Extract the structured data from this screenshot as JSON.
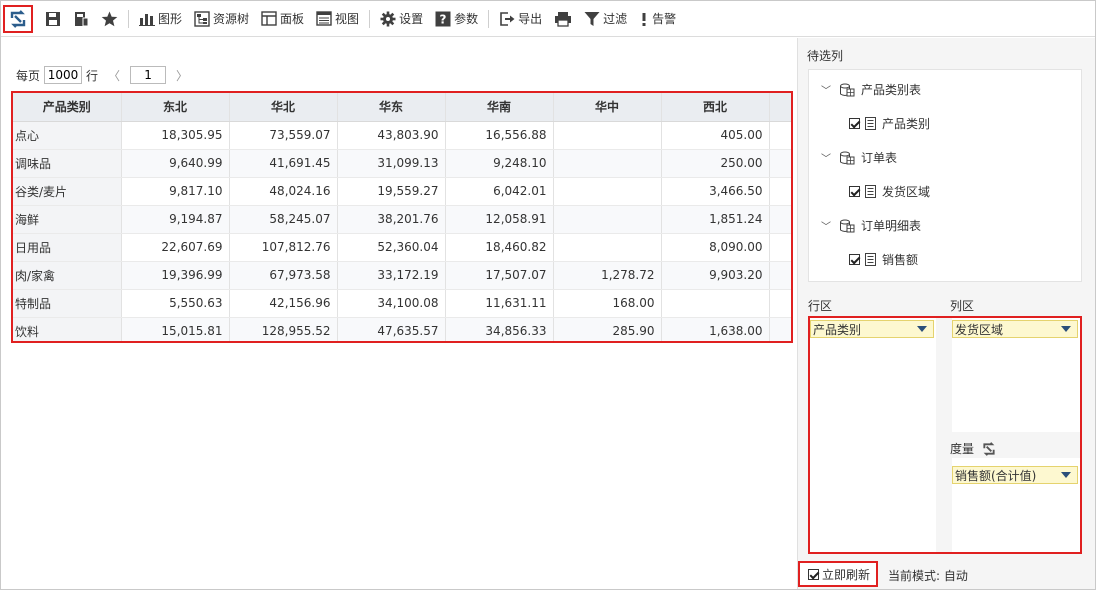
{
  "toolbar": {
    "buttons": [
      {
        "label": "",
        "icon": "save-icon"
      },
      {
        "label": "",
        "icon": "save-as-icon"
      },
      {
        "label": "",
        "icon": "star-icon"
      },
      {
        "label": "图形",
        "icon": "bar-chart-icon"
      },
      {
        "label": "资源树",
        "icon": "resource-tree-icon"
      },
      {
        "label": "面板",
        "icon": "panel-icon"
      },
      {
        "label": "视图",
        "icon": "view-icon"
      },
      {
        "label": "设置",
        "icon": "gear-icon"
      },
      {
        "label": "参数",
        "icon": "question-icon"
      },
      {
        "label": "导出",
        "icon": "export-icon"
      },
      {
        "label": "",
        "icon": "print-icon"
      },
      {
        "label": "过滤",
        "icon": "filter-icon"
      },
      {
        "label": "告警",
        "icon": "alert-icon"
      }
    ]
  },
  "pager": {
    "prefix": "每页",
    "page_size": "1000",
    "suffix": "行",
    "prev": "〈",
    "page": "1",
    "next": "〉"
  },
  "table": {
    "corner_header": "产品类别",
    "columns": [
      "东北",
      "华北",
      "华东",
      "华南",
      "华中",
      "西北"
    ],
    "rows": [
      {
        "label": "点心",
        "values": [
          "18,305.95",
          "73,559.07",
          "43,803.90",
          "16,556.88",
          "",
          "405.00"
        ]
      },
      {
        "label": "调味品",
        "values": [
          "9,640.99",
          "41,691.45",
          "31,099.13",
          "9,248.10",
          "",
          "250.00"
        ]
      },
      {
        "label": "谷类/麦片",
        "values": [
          "9,817.10",
          "48,024.16",
          "19,559.27",
          "6,042.01",
          "",
          "3,466.50"
        ]
      },
      {
        "label": "海鲜",
        "values": [
          "9,194.87",
          "58,245.07",
          "38,201.76",
          "12,058.91",
          "",
          "1,851.24"
        ]
      },
      {
        "label": "日用品",
        "values": [
          "22,607.69",
          "107,812.76",
          "52,360.04",
          "18,460.82",
          "",
          "8,090.00"
        ]
      },
      {
        "label": "肉/家禽",
        "values": [
          "19,396.99",
          "67,973.58",
          "33,172.19",
          "17,507.07",
          "1,278.72",
          "9,903.20"
        ]
      },
      {
        "label": "特制品",
        "values": [
          "5,550.63",
          "42,156.96",
          "34,100.08",
          "11,631.11",
          "168.00",
          ""
        ]
      },
      {
        "label": "饮料",
        "values": [
          "15,015.81",
          "128,955.52",
          "47,635.57",
          "34,856.33",
          "285.90",
          "1,638.00"
        ]
      }
    ]
  },
  "panel": {
    "candidates_title": "待选列",
    "tree": [
      {
        "table": "产品类别表",
        "field": "产品类别"
      },
      {
        "table": "订单表",
        "field": "发货区域"
      },
      {
        "table": "订单明细表",
        "field": "销售额"
      }
    ],
    "row_zone_title": "行区",
    "col_zone_title": "列区",
    "measure_title": "度量",
    "row_field": "产品类别",
    "col_field": "发货区域",
    "measure_field": "销售额(合计值)",
    "auto_refresh_label": "立即刷新",
    "mode_text": "当前模式: 自动"
  },
  "colors": {
    "highlight_border": "#e02020",
    "header_bg": "#eaedf1",
    "pill_bg": "#fdf8d0",
    "icon_dark": "#404040",
    "refresh_blue": "#2b5d8c"
  }
}
